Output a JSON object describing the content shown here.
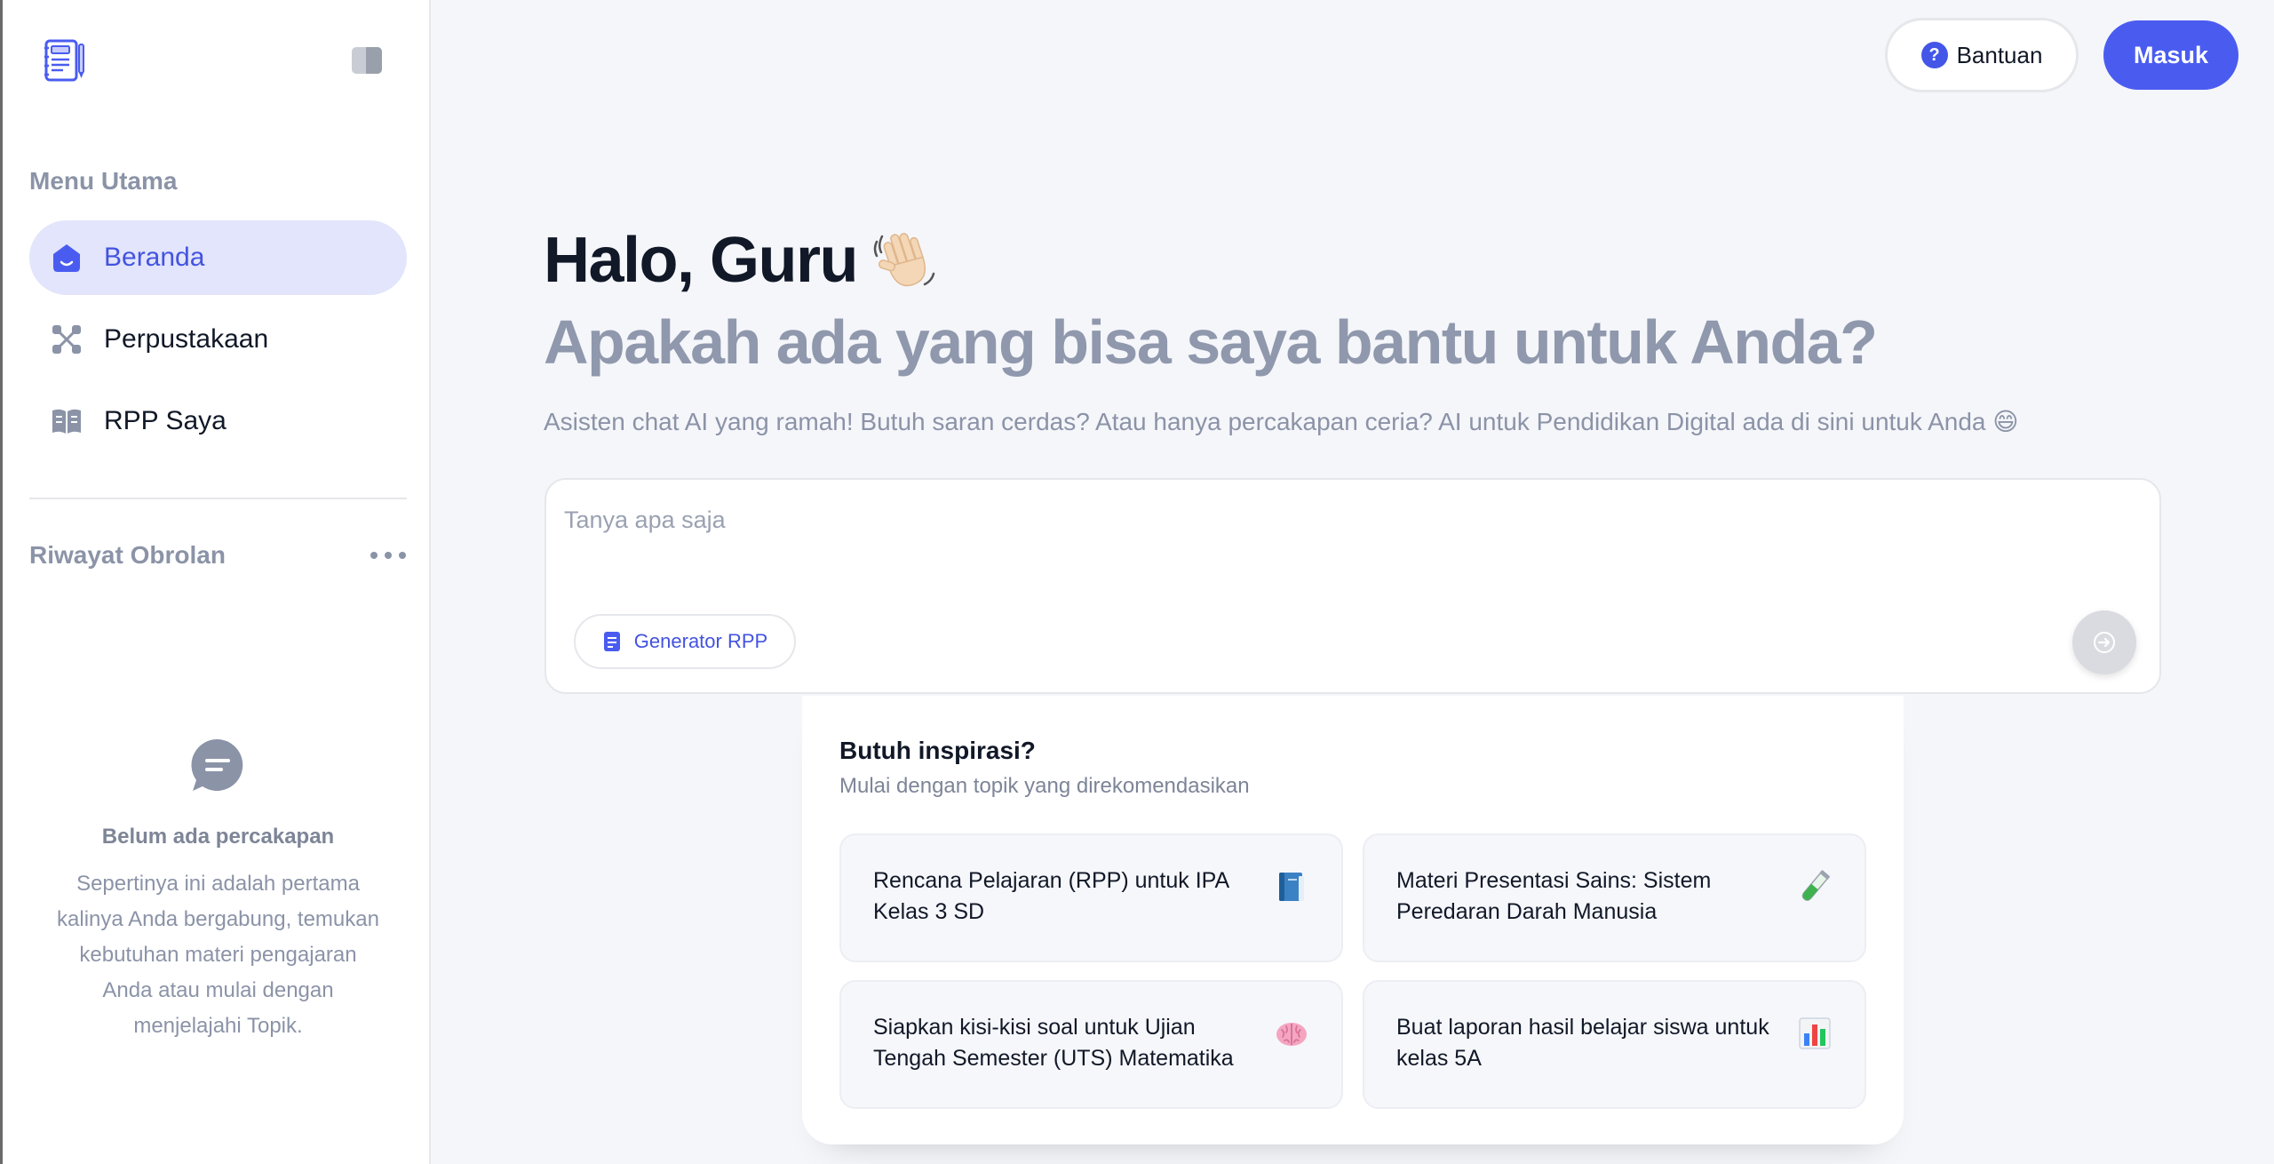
{
  "sidebar": {
    "menu_title": "Menu Utama",
    "items": [
      {
        "label": "Beranda",
        "icon": "home-icon",
        "active": true
      },
      {
        "label": "Perpustakaan",
        "icon": "library-icon",
        "active": false
      },
      {
        "label": "RPP Saya",
        "icon": "book-open-icon",
        "active": false
      }
    ],
    "history_title": "Riwayat Obrolan",
    "empty_title": "Belum ada percakapan",
    "empty_text": "Sepertinya ini adalah pertama kalinya Anda bergabung, temukan kebutuhan materi pengajaran Anda atau mulai dengan menjelajahi Topik."
  },
  "header": {
    "help_label": "Bantuan",
    "login_label": "Masuk"
  },
  "hero": {
    "greeting": "Halo, Guru",
    "subheading": "Apakah ada yang bisa saya bantu untuk Anda?",
    "tagline": "Asisten chat AI yang ramah! Butuh saran cerdas? Atau hanya percakapan ceria? AI untuk Pendidikan Digital ada di sini untuk Anda 😄"
  },
  "chat": {
    "placeholder": "Tanya apa saja",
    "tool_label": "Generator RPP"
  },
  "inspiration": {
    "title": "Butuh inspirasi?",
    "subtitle": "Mulai dengan topik yang direkomendasikan",
    "suggestions": [
      {
        "text": "Rencana Pelajaran (RPP) untuk IPA Kelas 3 SD",
        "icon": "book-icon"
      },
      {
        "text": "Materi Presentasi Sains: Sistem Peredaran Darah Manusia",
        "icon": "test-tube-icon"
      },
      {
        "text": "Siapkan kisi-kisi soal untuk Ujian Tengah Semester (UTS) Matematika",
        "icon": "brain-icon"
      },
      {
        "text": "Buat laporan hasil belajar siswa untuk kelas 5A",
        "icon": "bar-chart-icon"
      }
    ]
  },
  "colors": {
    "accent": "#4a5cf0",
    "active_bg": "#e2e5fb",
    "muted_text": "#8f98ac",
    "page_bg": "#f5f6fa"
  }
}
